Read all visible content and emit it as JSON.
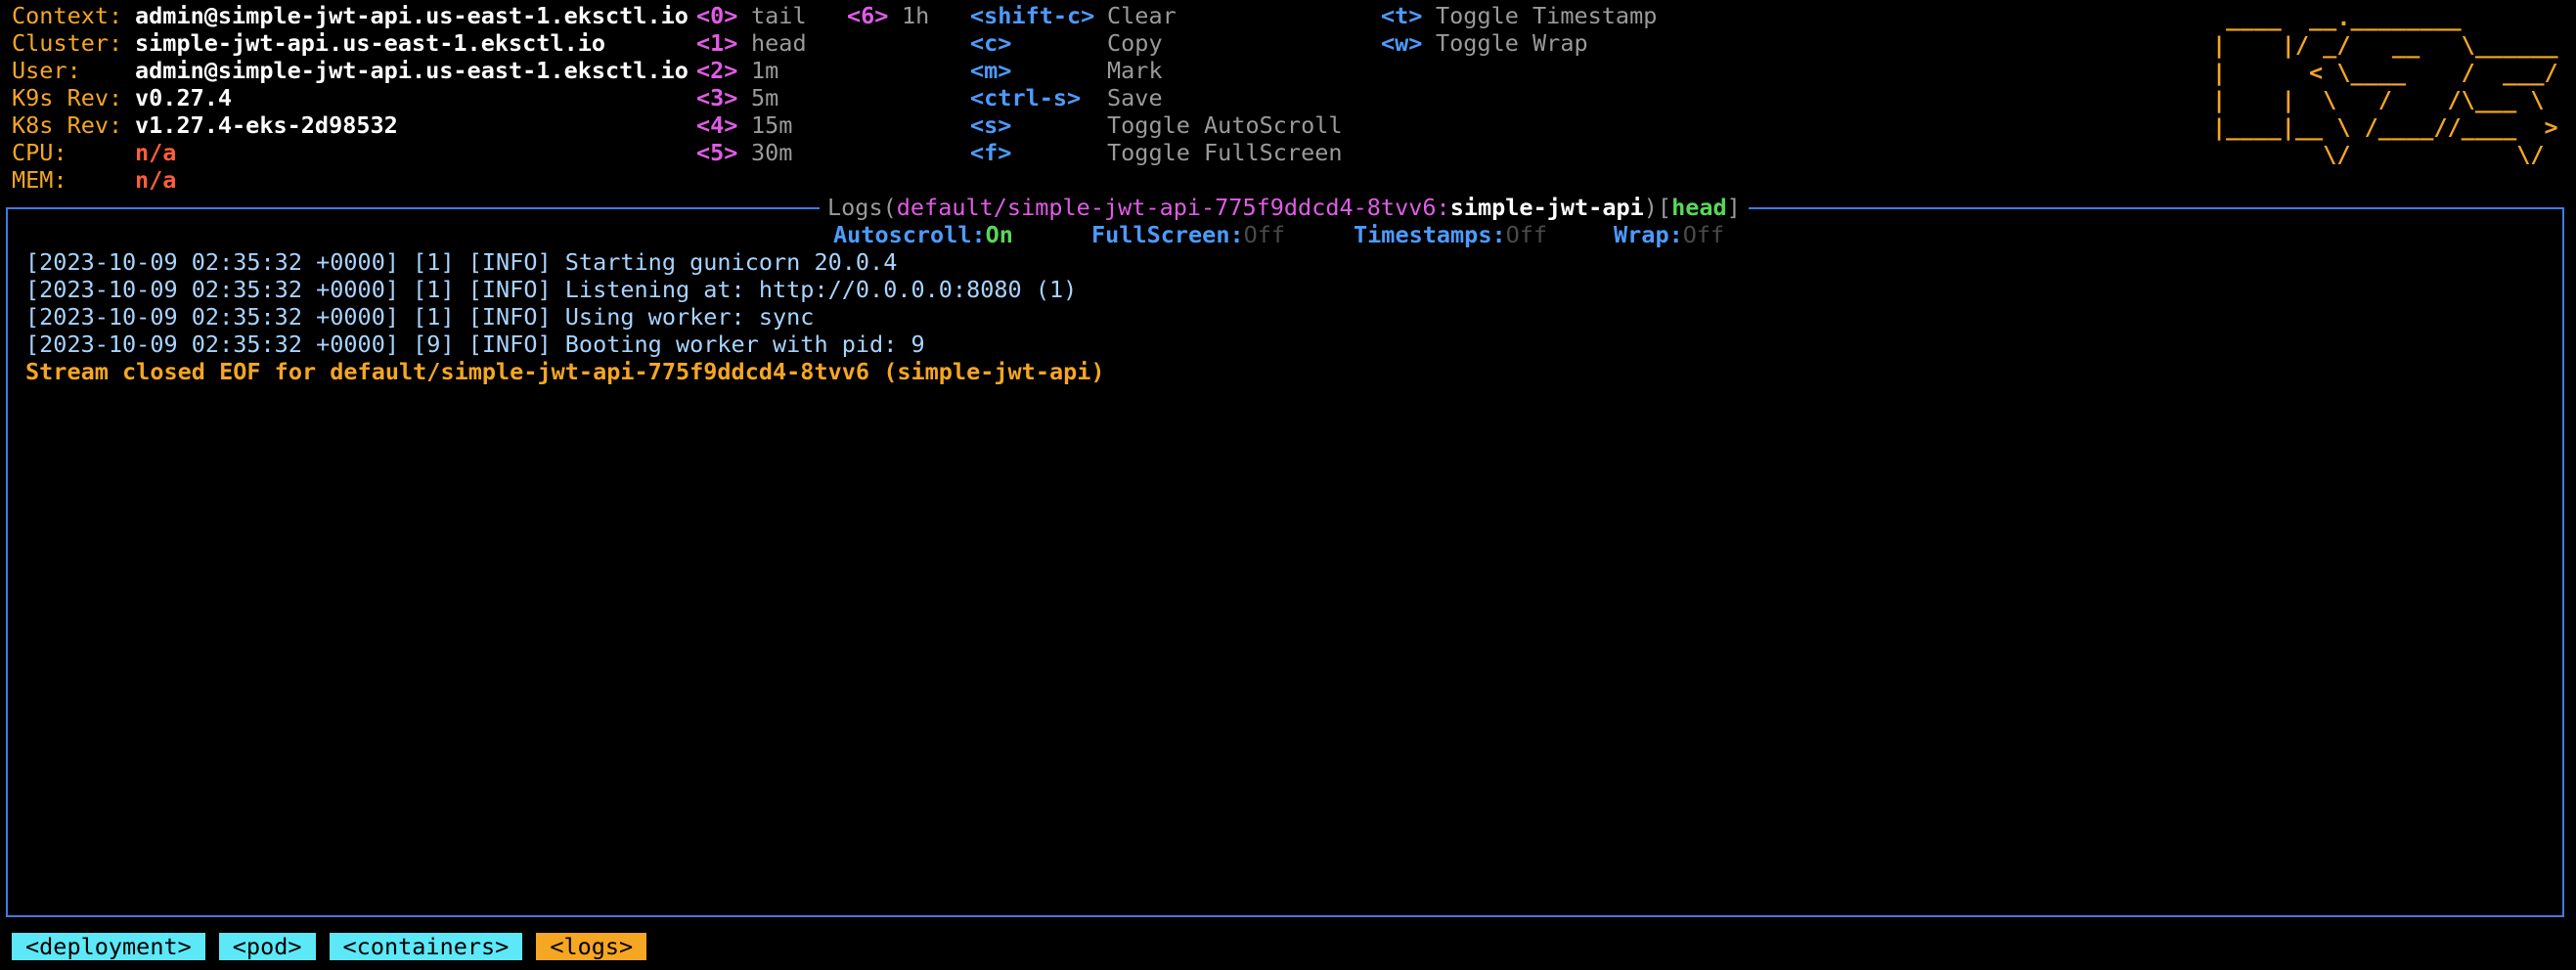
{
  "info": [
    {
      "label": "Context:",
      "value": "admin@simple-jwt-api.us-east-1.eksctl.io",
      "kind": "white"
    },
    {
      "label": "Cluster:",
      "value": "simple-jwt-api.us-east-1.eksctl.io",
      "kind": "white"
    },
    {
      "label": "User:",
      "value": "admin@simple-jwt-api.us-east-1.eksctl.io",
      "kind": "white"
    },
    {
      "label": "K9s Rev:",
      "value": "v0.27.4",
      "kind": "white"
    },
    {
      "label": "K8s Rev:",
      "value": "v1.27.4-eks-2d98532",
      "kind": "white"
    },
    {
      "label": "CPU:",
      "value": "n/a",
      "kind": "red"
    },
    {
      "label": "MEM:",
      "value": "n/a",
      "kind": "red"
    }
  ],
  "time_keys": [
    {
      "key": "<0>",
      "label": "tail"
    },
    {
      "key": "<1>",
      "label": "head"
    },
    {
      "key": "<2>",
      "label": "1m"
    },
    {
      "key": "<3>",
      "label": "5m"
    },
    {
      "key": "<4>",
      "label": "15m"
    },
    {
      "key": "<5>",
      "label": "30m"
    },
    {
      "key": "<6>",
      "label": "1h"
    }
  ],
  "action_keys": [
    {
      "key": "<shift-c>",
      "label": "Clear"
    },
    {
      "key": "<c>",
      "label": "Copy"
    },
    {
      "key": "<m>",
      "label": "Mark"
    },
    {
      "key": "<ctrl-s>",
      "label": "Save"
    },
    {
      "key": "<s>",
      "label": "Toggle AutoScroll"
    },
    {
      "key": "<f>",
      "label": "Toggle FullScreen"
    }
  ],
  "toggle_keys": [
    {
      "key": "<t>",
      "label": "Toggle Timestamp"
    },
    {
      "key": "<w>",
      "label": "Toggle Wrap"
    }
  ],
  "logo_lines": [
    " ____  __.________",
    "|    |/ _/   __   \\______",
    "|      < \\____    /  ___/",
    "|    |  \\   /    /\\___ \\",
    "|____|__ \\ /____//____  >",
    "        \\/            \\/"
  ],
  "panel": {
    "title_prefix": "Logs(",
    "path": "default/simple-jwt-api-775f9ddcd4-8tvv6:",
    "container": "simple-jwt-api",
    "close_paren": ")",
    "mode_open": "[",
    "mode": "head",
    "mode_close": "]"
  },
  "status": [
    {
      "label": "Autoscroll:",
      "value": "On",
      "on": true
    },
    {
      "label": "FullScreen:",
      "value": "Off",
      "on": false
    },
    {
      "label": "Timestamps:",
      "value": "Off",
      "on": false
    },
    {
      "label": "Wrap:",
      "value": "Off",
      "on": false
    }
  ],
  "logs": [
    "[2023-10-09 02:35:32 +0000] [1] [INFO] Starting gunicorn 20.0.4",
    "[2023-10-09 02:35:32 +0000] [1] [INFO] Listening at: http://0.0.0.0:8080 (1)",
    "[2023-10-09 02:35:32 +0000] [1] [INFO] Using worker: sync",
    "[2023-10-09 02:35:32 +0000] [9] [INFO] Booting worker with pid: 9"
  ],
  "stream_closed": "Stream closed EOF for default/simple-jwt-api-775f9ddcd4-8tvv6 (simple-jwt-api)",
  "crumbs": [
    {
      "label": "<deployment>",
      "active": false
    },
    {
      "label": "<pod>",
      "active": false
    },
    {
      "label": "<containers>",
      "active": false
    },
    {
      "label": "<logs>",
      "active": true
    }
  ],
  "colors": {
    "accent": "#f5a623",
    "border": "#3d7de0",
    "key_magenta": "#e05ce6",
    "key_blue": "#4d9bff",
    "crumb": "#5ce8f7"
  }
}
